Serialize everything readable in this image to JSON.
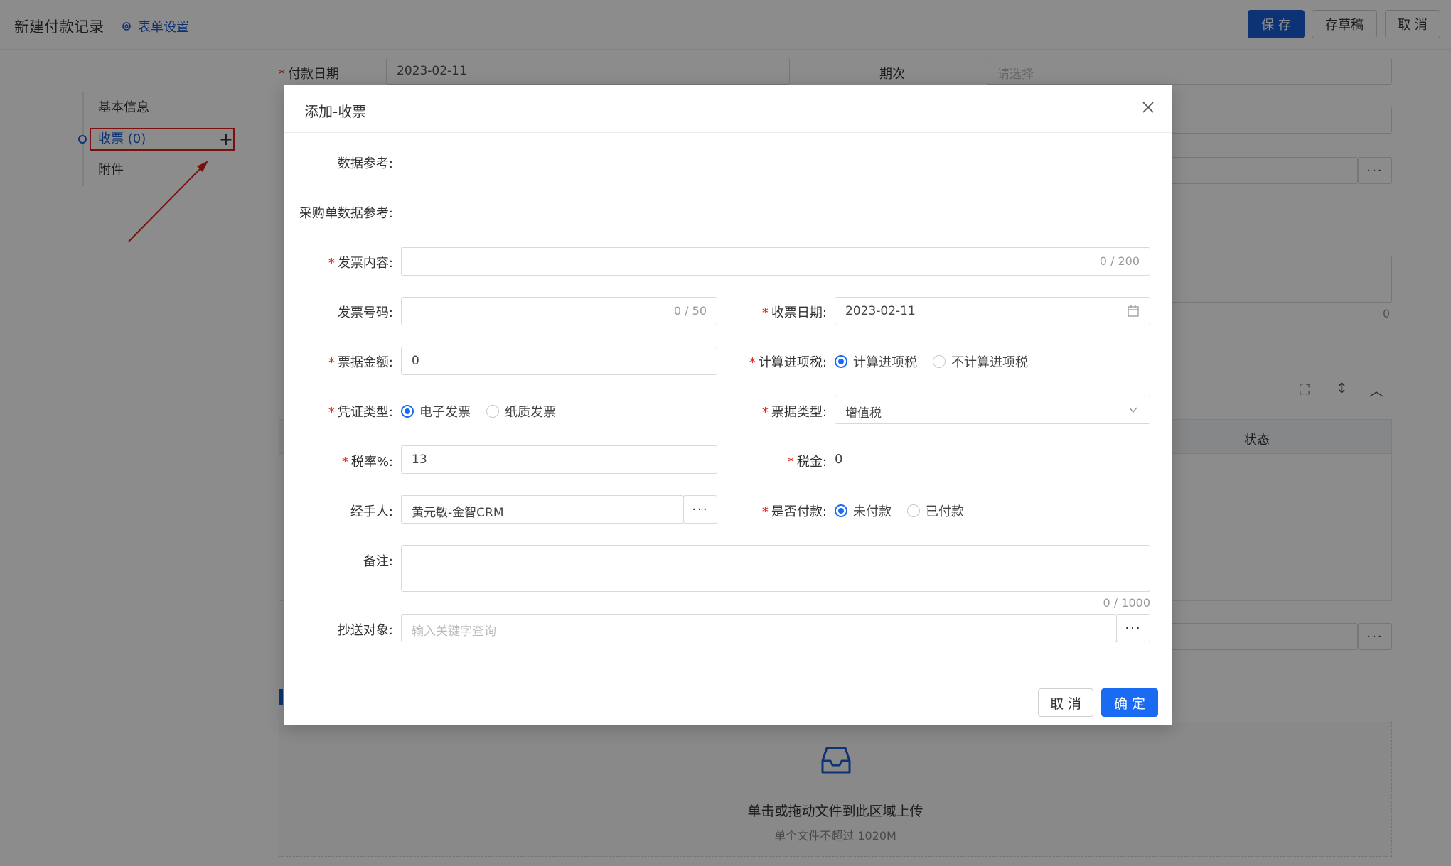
{
  "topbar": {
    "title": "新建付款记录",
    "form_settings": "表单设置",
    "save": "保 存",
    "draft": "存草稿",
    "cancel": "取 消"
  },
  "side_nav": {
    "items": [
      {
        "label": "基本信息"
      },
      {
        "label": "收票 (0)"
      },
      {
        "label": "附件"
      }
    ]
  },
  "background_form": {
    "payment_date_label": "付款日期",
    "payment_date_value": "2023-02-11",
    "period_label": "期次",
    "period_placeholder": "请选择",
    "counter_right": "0",
    "table_status_header": "状态",
    "upload_text": "单击或拖动文件到此区域上传",
    "upload_hint": "单个文件不超过 1020M"
  },
  "modal": {
    "title": "添加-收票",
    "fields": {
      "data_ref": {
        "label": "数据参考:"
      },
      "po_ref": {
        "label": "采购单数据参考:"
      },
      "invoice_content": {
        "label": "发票内容:",
        "counter": "0 / 200"
      },
      "invoice_no": {
        "label": "发票号码:",
        "counter": "0 / 50"
      },
      "receipt_date": {
        "label": "收票日期:",
        "value": "2023-02-11"
      },
      "amount": {
        "label": "票据金额:",
        "value": "0"
      },
      "input_tax": {
        "label": "计算进项税:",
        "options": [
          "计算进项税",
          "不计算进项税"
        ],
        "selected": "计算进项税"
      },
      "voucher_type": {
        "label": "凭证类型:",
        "options": [
          "电子发票",
          "纸质发票"
        ],
        "selected": "电子发票"
      },
      "bill_type": {
        "label": "票据类型:",
        "value": "增值税"
      },
      "tax_rate": {
        "label": "税率%:",
        "value": "13"
      },
      "tax_amount": {
        "label": "税金:",
        "value": "0"
      },
      "handler": {
        "label": "经手人:",
        "value": "黄元敏-金智CRM"
      },
      "paid": {
        "label": "是否付款:",
        "options": [
          "未付款",
          "已付款"
        ],
        "selected": "未付款"
      },
      "remark": {
        "label": "备注:",
        "counter": "0 / 1000"
      },
      "cc": {
        "label": "抄送对象:",
        "placeholder": "输入关键字查询"
      }
    },
    "dots": "···",
    "cancel": "取 消",
    "ok": "确 定"
  },
  "colors": {
    "primary": "#1a6bf3",
    "required": "#e0201a",
    "annotation": "#e0201a"
  }
}
